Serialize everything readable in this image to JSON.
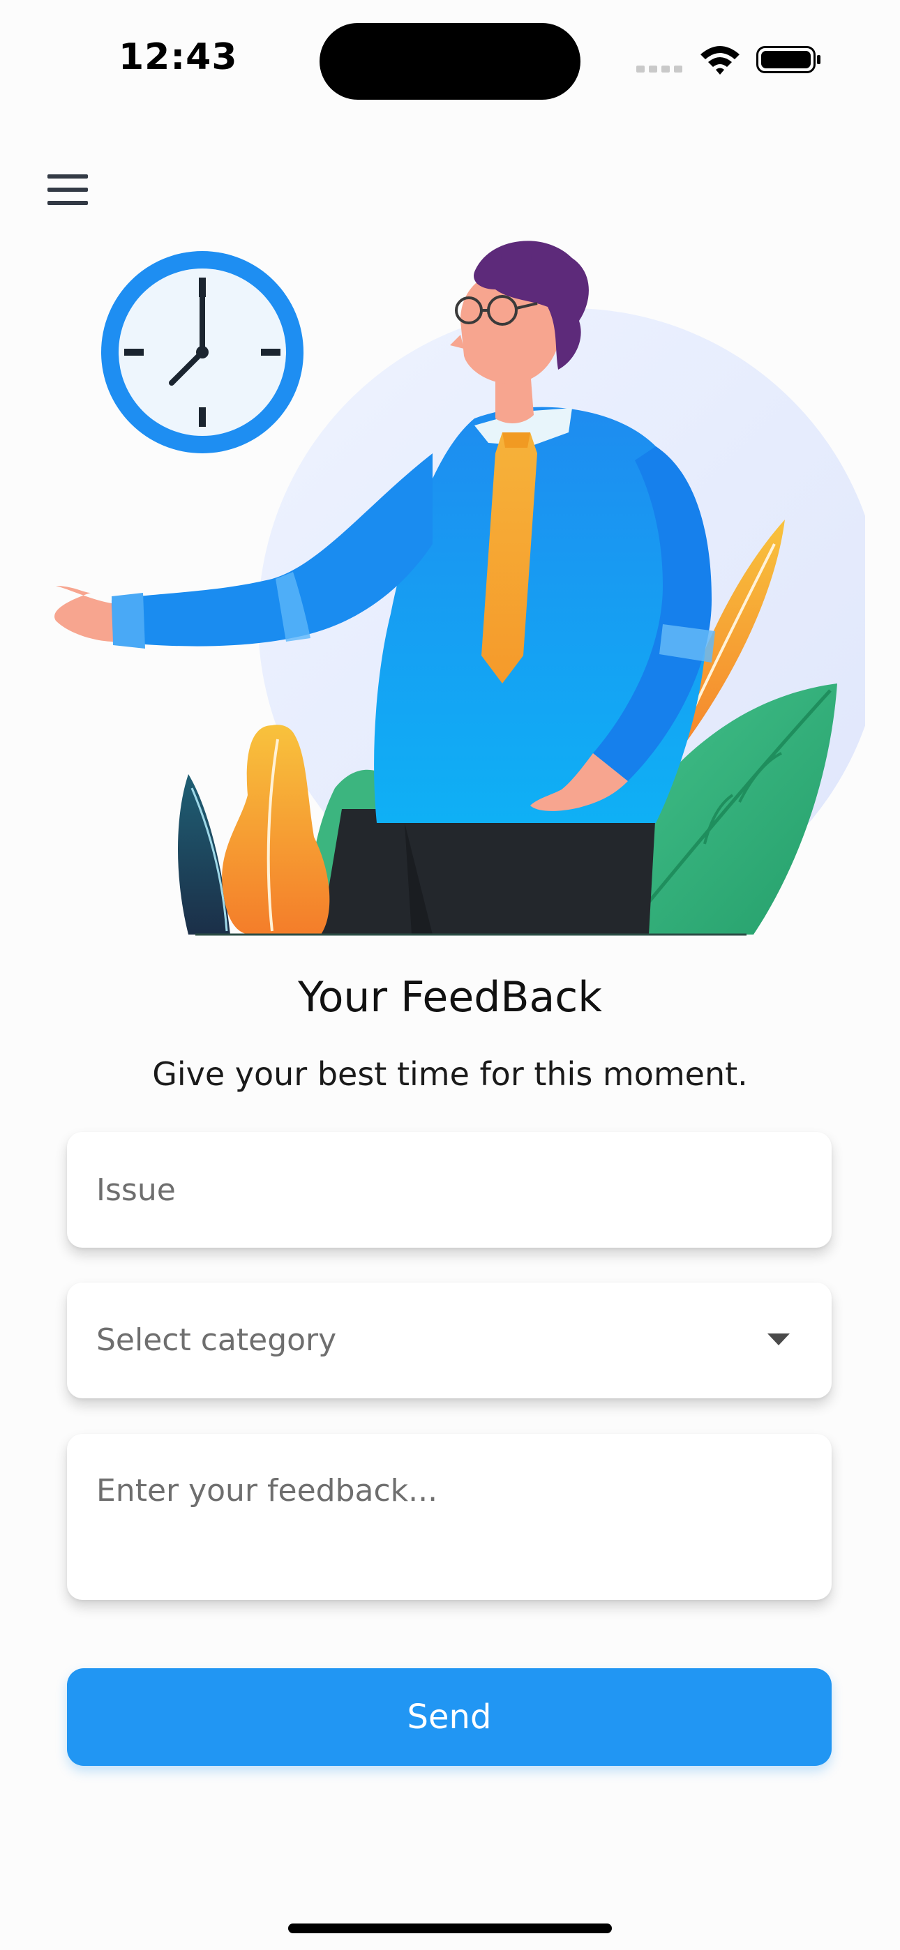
{
  "status_bar": {
    "time": "12:43",
    "icons": [
      "cellular-signal-icon",
      "wifi-icon",
      "battery-icon"
    ]
  },
  "header": {
    "menu_icon": "hamburger-menu-icon"
  },
  "illustration": {
    "elements": [
      "clock-icon",
      "man-pointing-illustration",
      "plant-leaves"
    ]
  },
  "content": {
    "title": "Your FeedBack",
    "subtitle": "Give your best time for this moment."
  },
  "form": {
    "issue_placeholder": "Issue",
    "category_value": "Select category",
    "feedback_placeholder": "Enter your feedback...",
    "send_label": "Send"
  },
  "colors": {
    "accent": "#2196f3",
    "background": "#fcfcfc"
  }
}
